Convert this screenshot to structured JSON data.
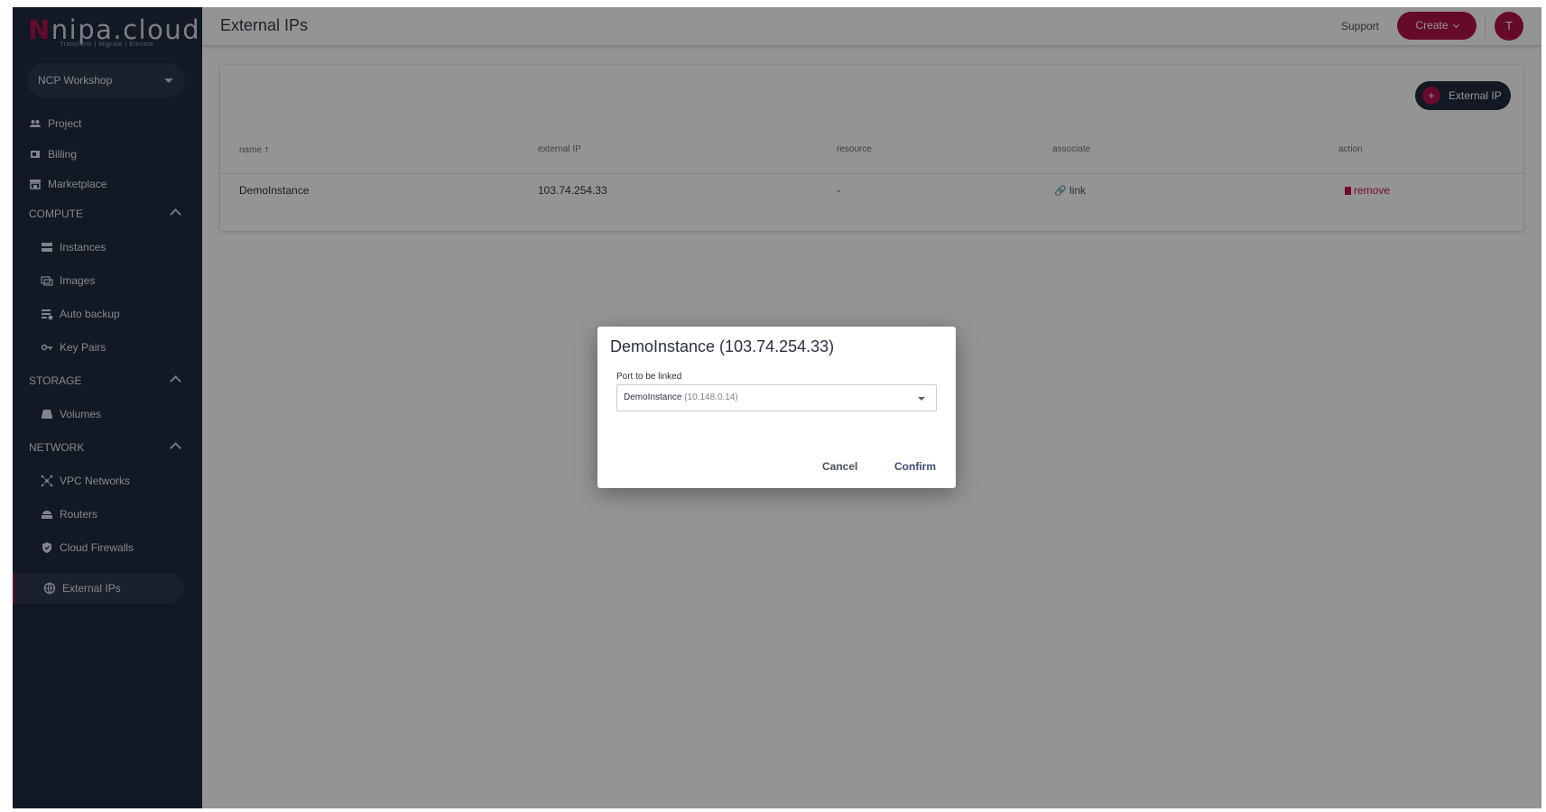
{
  "brand": {
    "name_initial": "N",
    "name_rest": "nipa.cloud",
    "tagline": "Transform | Migrate | Elevate"
  },
  "sidebar": {
    "project_select": "NCP Workshop",
    "top_items": [
      {
        "label": "Project",
        "icon": "people-icon"
      },
      {
        "label": "Billing",
        "icon": "billing-icon"
      },
      {
        "label": "Marketplace",
        "icon": "store-icon"
      }
    ],
    "sections": {
      "compute": {
        "title": "COMPUTE",
        "items": [
          {
            "label": "Instances",
            "icon": "server-icon"
          },
          {
            "label": "Images",
            "icon": "images-icon"
          },
          {
            "label": "Auto backup",
            "icon": "backup-icon"
          },
          {
            "label": "Key Pairs",
            "icon": "key-icon"
          }
        ]
      },
      "storage": {
        "title": "STORAGE",
        "items": [
          {
            "label": "Volumes",
            "icon": "volume-icon"
          }
        ]
      },
      "network": {
        "title": "NETWORK",
        "items": [
          {
            "label": "VPC Networks",
            "icon": "network-icon"
          },
          {
            "label": "Routers",
            "icon": "router-icon"
          },
          {
            "label": "Cloud Firewalls",
            "icon": "shield-icon"
          },
          {
            "label": "External IPs",
            "icon": "globe-icon"
          }
        ]
      }
    }
  },
  "header": {
    "title": "External IPs",
    "support": "Support",
    "create": "Create",
    "avatar": "T"
  },
  "table": {
    "add_button": "External IP",
    "columns": {
      "name": "name",
      "external_ip": "external IP",
      "resource": "resource",
      "associate": "associate",
      "action": "action"
    },
    "rows": [
      {
        "name": "DemoInstance",
        "external_ip": "103.74.254.33",
        "resource": "-",
        "associate": "link",
        "action": "remove"
      }
    ]
  },
  "dialog": {
    "title": "DemoInstance (103.74.254.33)",
    "field_label": "Port to be linked",
    "selected_name": "DemoInstance",
    "selected_ip": "(10.148.0.14)",
    "cancel": "Cancel",
    "confirm": "Confirm"
  },
  "colors": {
    "sidebar_bg": "#1f2a3e",
    "accent": "#b0124c",
    "remove": "#c4124d"
  }
}
